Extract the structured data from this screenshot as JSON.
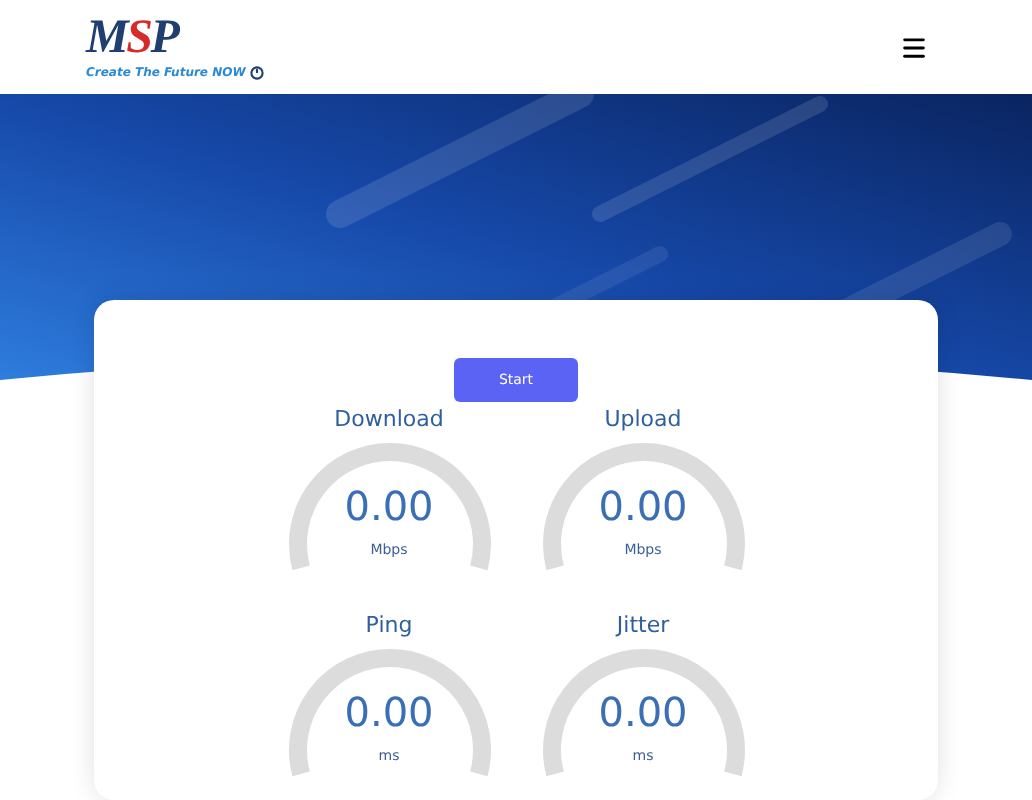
{
  "logo": {
    "letters": [
      {
        "char": "M",
        "color": "#1f3f73"
      },
      {
        "char": "S",
        "color": "#d62b2b"
      },
      {
        "char": "P",
        "color": "#1f3f73"
      }
    ],
    "tagline": "Create The Future **NOW**"
  },
  "start_button": "Start",
  "gauges": [
    {
      "label": "Download",
      "value": "0.00",
      "unit": "Mbps"
    },
    {
      "label": "Upload",
      "value": "0.00",
      "unit": "Mbps"
    },
    {
      "label": "Ping",
      "value": "0.00",
      "unit": "ms"
    },
    {
      "label": "Jitter",
      "value": "0.00",
      "unit": "ms"
    }
  ]
}
